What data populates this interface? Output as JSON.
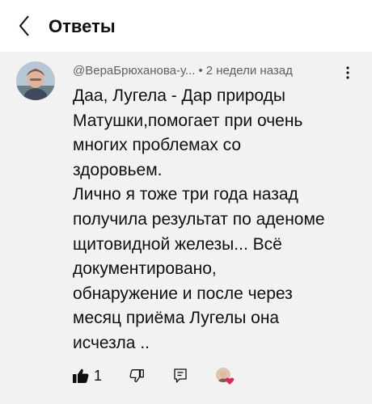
{
  "header": {
    "title": "Ответы"
  },
  "comment": {
    "author": "@ВераБрюханова-у...",
    "separator": "•",
    "time": "2 недели назад",
    "text": "Даа, Лугела - Дар природы\nМатушки,помогает при очень\nмногих проблемах со\nздоровьем.\nЛично я тоже три года назад\nполучила результат по аденоме\nщитовидной железы... Всё\nдокументировано,\nобнаружение и после через\nмесяц приёма Лугелы она\nисчезла ..",
    "like_count": "1"
  },
  "icons": {
    "back": "chevron-left-icon",
    "more": "more-vertical-icon",
    "like": "thumb-up-filled-icon",
    "dislike": "thumb-down-outline-icon",
    "reply": "reply-comment-icon",
    "creator_heart": "creator-heart-icon"
  },
  "colors": {
    "comment_background": "#f2f2f2",
    "meta_text": "#606060",
    "heart": "#e0245e"
  }
}
